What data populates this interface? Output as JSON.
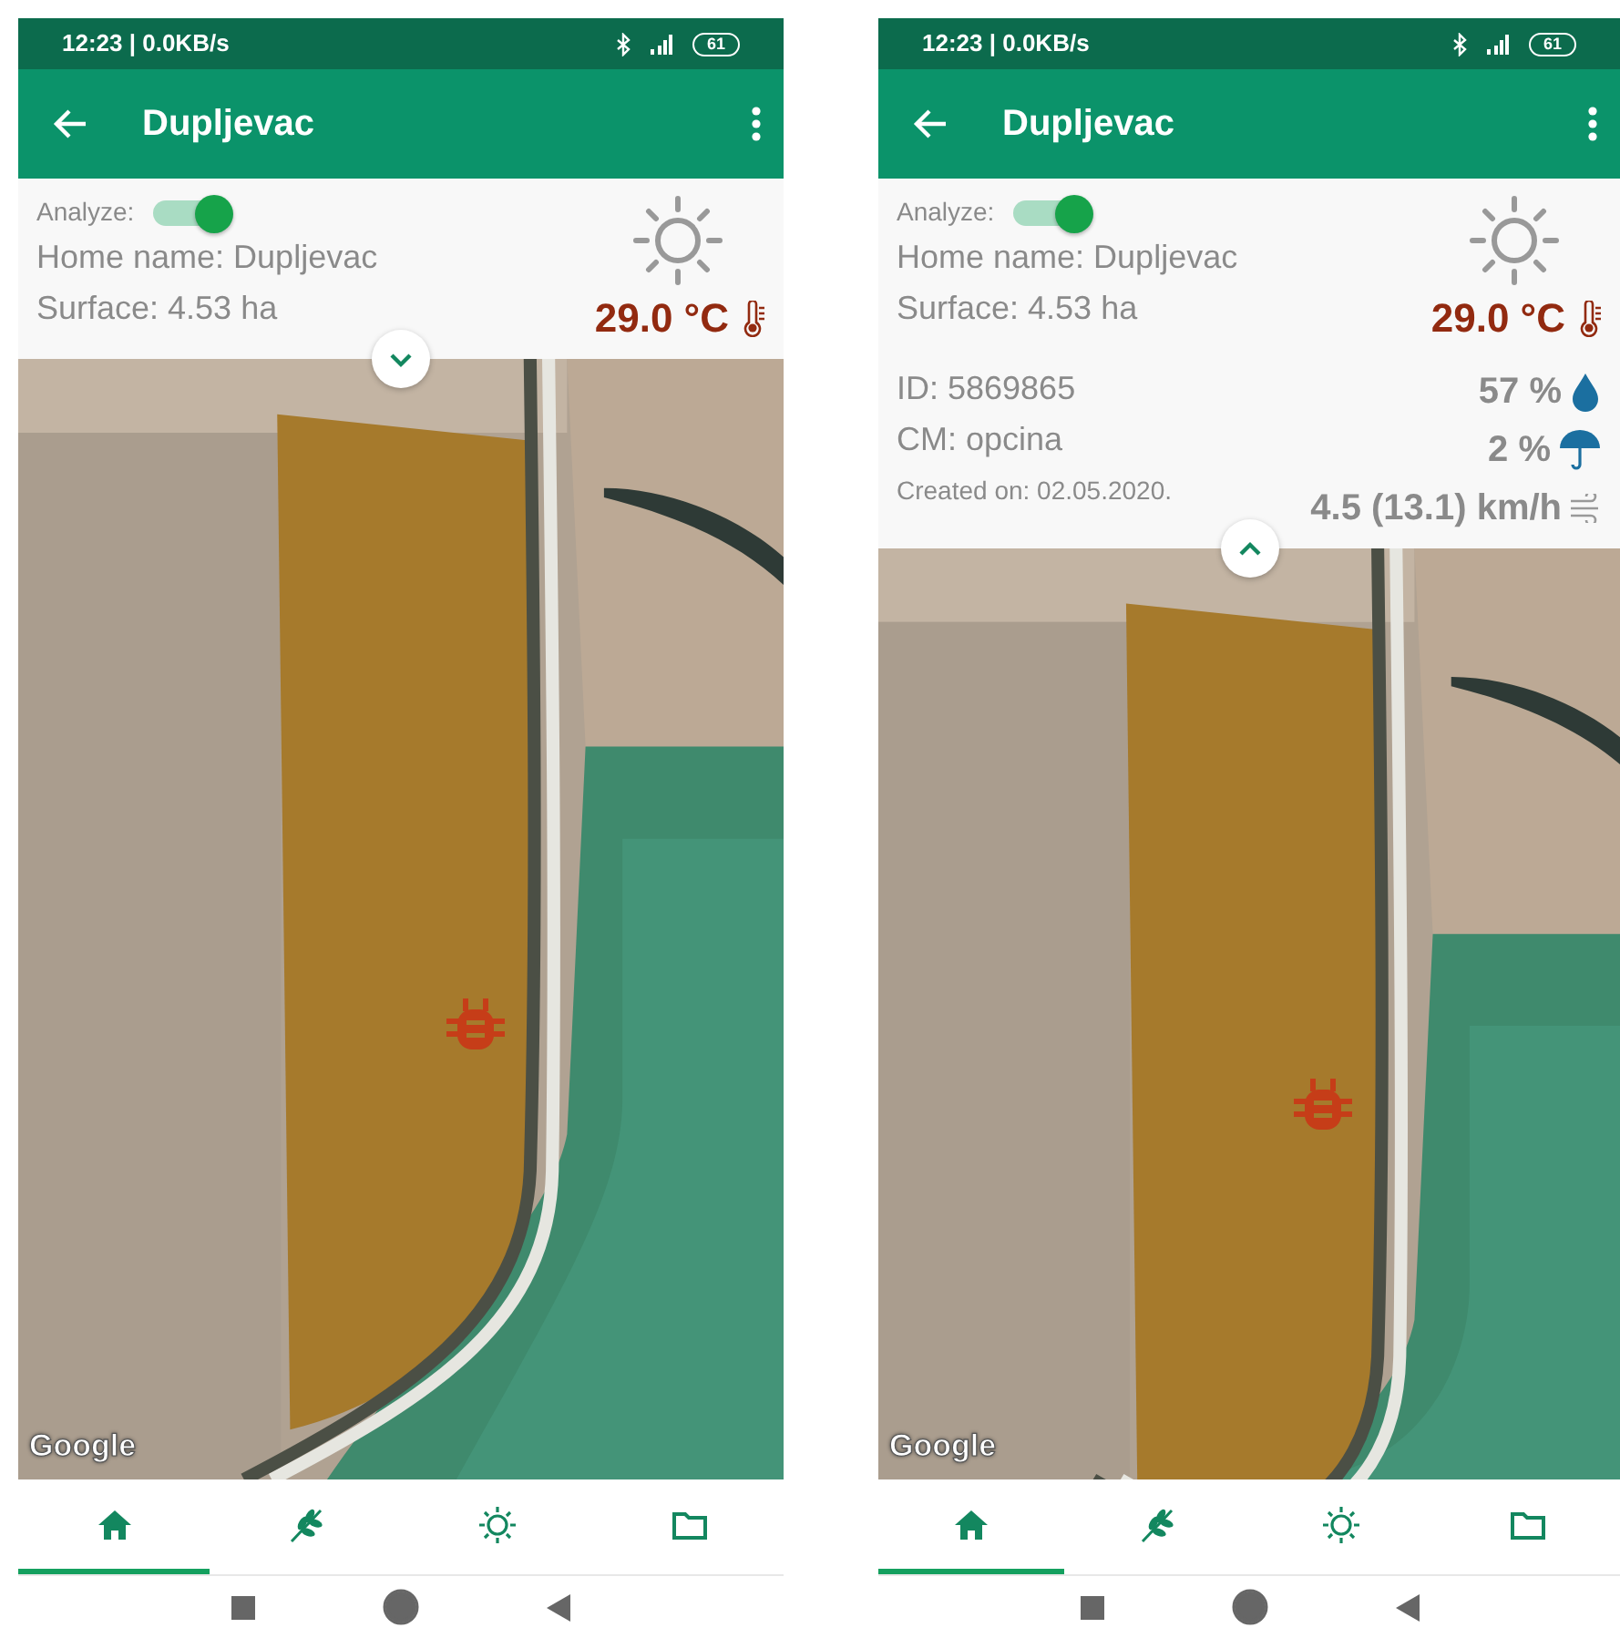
{
  "screens": [
    {
      "status_bar": {
        "time": "12:23 | 0.0KB/s",
        "battery": "61"
      },
      "app_bar": {
        "title": "Dupljevac"
      },
      "info": {
        "analyze_label": "Analyze:",
        "analyze_on": true,
        "home_name": "Home name: Dupljevac",
        "surface": "Surface: 4.53 ha",
        "temperature": "29.0 °C",
        "expanded": false
      },
      "map": {
        "attribution": "Google"
      },
      "bottom_nav": [
        {
          "kind": "home",
          "selected": true
        },
        {
          "kind": "crop",
          "selected": false
        },
        {
          "kind": "weather",
          "selected": false
        },
        {
          "kind": "folder",
          "selected": false
        }
      ]
    },
    {
      "status_bar": {
        "time": "12:23 | 0.0KB/s",
        "battery": "61"
      },
      "app_bar": {
        "title": "Dupljevac"
      },
      "info": {
        "analyze_label": "Analyze:",
        "analyze_on": true,
        "home_name": "Home name: Dupljevac",
        "surface": "Surface: 4.53 ha",
        "temperature": "29.0 °C",
        "expanded": true,
        "details": {
          "id": "ID: 5869865",
          "cm": "CM: opcina",
          "created_on": "Created on: 02.05.2020.",
          "humidity": "57 %",
          "precipitation": "2 %",
          "wind": "4.5 (13.1) km/h"
        }
      },
      "map": {
        "attribution": "Google"
      },
      "bottom_nav": [
        {
          "kind": "home",
          "selected": true
        },
        {
          "kind": "crop",
          "selected": false
        },
        {
          "kind": "weather",
          "selected": false
        },
        {
          "kind": "folder",
          "selected": false
        }
      ]
    }
  ]
}
